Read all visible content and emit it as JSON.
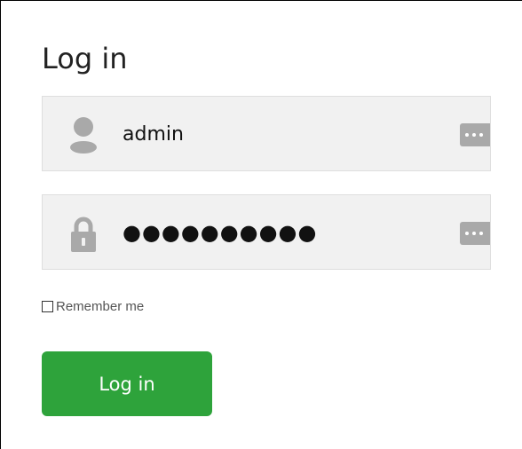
{
  "form": {
    "title": "Log in",
    "username": {
      "icon": "user-icon",
      "value": "admin"
    },
    "password": {
      "icon": "lock-icon",
      "value": "●●●●●●●●●●"
    },
    "password_manager_icon": "password-manager-icon",
    "remember_me": {
      "label": "Remember me",
      "checked": false
    },
    "submit_label": "Log in"
  },
  "colors": {
    "field_background": "#f1f1f1",
    "field_border": "#dedede",
    "icon_gray": "#a9a9a9",
    "button_green": "#2ea33b",
    "button_text": "#ffffff",
    "title_text": "#222222"
  }
}
